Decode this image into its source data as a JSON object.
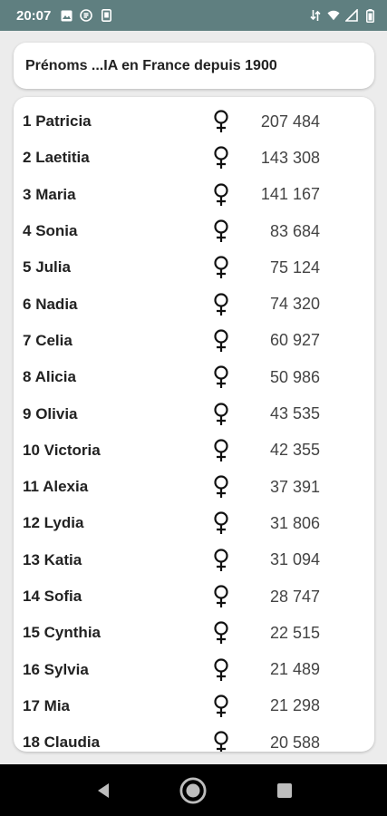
{
  "status_bar": {
    "time": "20:07",
    "left_icons": [
      "image-icon",
      "media-icon",
      "sd-card-icon"
    ],
    "right_icons": [
      "data-sync-icon",
      "wifi-icon",
      "signal-icon",
      "battery-icon"
    ]
  },
  "header": {
    "title": "Prénoms ...IA en France depuis 1900"
  },
  "list": {
    "items": [
      {
        "rank": "1",
        "name": "Patricia",
        "sex": "female-symbol-icon",
        "count": "207 484"
      },
      {
        "rank": "2",
        "name": "Laetitia",
        "sex": "female-symbol-icon",
        "count": "143 308"
      },
      {
        "rank": "3",
        "name": "Maria",
        "sex": "female-symbol-icon",
        "count": "141 167"
      },
      {
        "rank": "4",
        "name": "Sonia",
        "sex": "female-symbol-icon",
        "count": "83 684"
      },
      {
        "rank": "5",
        "name": "Julia",
        "sex": "female-symbol-icon",
        "count": "75 124"
      },
      {
        "rank": "6",
        "name": "Nadia",
        "sex": "female-symbol-icon",
        "count": "74 320"
      },
      {
        "rank": "7",
        "name": "Celia",
        "sex": "female-symbol-icon",
        "count": "60 927"
      },
      {
        "rank": "8",
        "name": "Alicia",
        "sex": "female-symbol-icon",
        "count": "50 986"
      },
      {
        "rank": "9",
        "name": "Olivia",
        "sex": "female-symbol-icon",
        "count": "43 535"
      },
      {
        "rank": "10",
        "name": "Victoria",
        "sex": "female-symbol-icon",
        "count": "42 355"
      },
      {
        "rank": "11",
        "name": "Alexia",
        "sex": "female-symbol-icon",
        "count": "37 391"
      },
      {
        "rank": "12",
        "name": "Lydia",
        "sex": "female-symbol-icon",
        "count": "31 806"
      },
      {
        "rank": "13",
        "name": "Katia",
        "sex": "female-symbol-icon",
        "count": "31 094"
      },
      {
        "rank": "14",
        "name": "Sofia",
        "sex": "female-symbol-icon",
        "count": "28 747"
      },
      {
        "rank": "15",
        "name": "Cynthia",
        "sex": "female-symbol-icon",
        "count": "22 515"
      },
      {
        "rank": "16",
        "name": "Sylvia",
        "sex": "female-symbol-icon",
        "count": "21 489"
      },
      {
        "rank": "17",
        "name": "Mia",
        "sex": "female-symbol-icon",
        "count": "21 298"
      },
      {
        "rank": "18",
        "name": "Claudia",
        "sex": "female-symbol-icon",
        "count": "20 588"
      }
    ]
  },
  "nav_bar": {
    "buttons": [
      "back-icon",
      "home-icon",
      "recents-icon"
    ]
  },
  "colors": {
    "status_bar": "#5f7f80",
    "background": "#ececec",
    "card": "#ffffff",
    "nav_bar": "#000000"
  }
}
